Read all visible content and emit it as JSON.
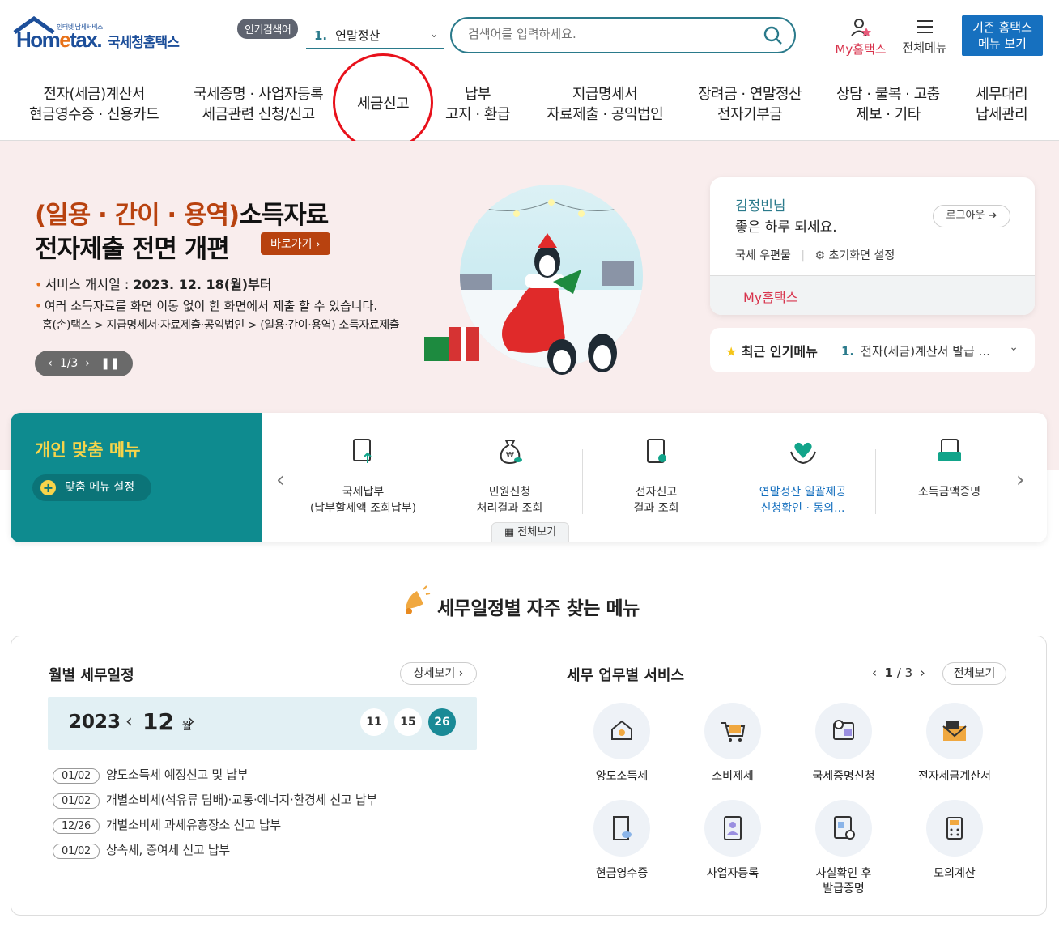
{
  "header": {
    "logo_small": "인터넷 납세서비스",
    "logo_main_a": "Hom",
    "logo_main_b": "e",
    "logo_main_c": "tax.",
    "logo_kr": "국세청홈택스",
    "popular_badge": "인기검색어",
    "popular_num": "1.",
    "popular_value": "연말정산",
    "search_placeholder": "검색어를 입력하세요.",
    "my_hometax": "My홈택스",
    "all_menu": "전체메뉴",
    "old_menu_line1": "기존 홈택스",
    "old_menu_line2": "메뉴 보기"
  },
  "nav": [
    {
      "l1": "전자(세금)계산서",
      "l2": "현금영수증 · 신용카드"
    },
    {
      "l1": "국세증명 · 사업자등록",
      "l2": "세금관련 신청/신고"
    },
    {
      "l1": "세금신고",
      "l2": ""
    },
    {
      "l1": "납부",
      "l2": "고지 · 환급"
    },
    {
      "l1": "지급명세서",
      "l2": "자료제출 · 공익법인"
    },
    {
      "l1": "장려금 · 연말정산",
      "l2": "전자기부금"
    },
    {
      "l1": "상담 · 불복 · 고충",
      "l2": "제보 · 기타"
    },
    {
      "l1": "세무대리",
      "l2": "납세관리"
    }
  ],
  "banner": {
    "title_highlight": "(일용 · 간이 · 용역)",
    "title_rest": "소득자료",
    "title2": "전자제출 전면 개편",
    "go_button": "바로가기",
    "line1_label": "서비스 개시일 : ",
    "line1_value": "2023. 12. 18(월)부터",
    "line2": "여러 소득자료를 화면 이동 없이 한 화면에서 제출 할 수 있습니다.",
    "line3": "홈(손)택스 > 지급명세서·자료제출·공익법인 > (일용·간이·용역) 소득자료제출",
    "pager": "1/3"
  },
  "login": {
    "user": "김정빈",
    "suffix": "님",
    "greeting": "좋은 하루 되세요.",
    "logout": "로그아웃",
    "mail": "국세 우편물",
    "settings": "초기화면 설정",
    "my_hometax": "My홈택스"
  },
  "recent": {
    "label": "최근 인기메뉴",
    "num": "1.",
    "value": "전자(세금)계산서 발급 ..."
  },
  "personal": {
    "title_a": "개인",
    "title_b": " 맞춤 메뉴",
    "setting": "맞춤 메뉴 설정",
    "view_all": "전체보기",
    "items": [
      {
        "l1": "국세납부",
        "l2": "(납부할세액 조회납부)"
      },
      {
        "l1": "민원신청",
        "l2": "처리결과 조회"
      },
      {
        "l1": "전자신고",
        "l2": "결과 조회"
      },
      {
        "l1": "연말정산 일괄제공",
        "l2": "신청확인 · 동의..."
      },
      {
        "l1": "소득금액증명",
        "l2": ""
      }
    ]
  },
  "schedule_section": {
    "title": "세무일정별 자주 찾는 메뉴",
    "monthly_title": "월별 세무일정",
    "detail_button": "상세보기",
    "year": "2023",
    "month": "12",
    "month_unit": "월",
    "days": [
      "11",
      "15",
      "26"
    ],
    "selected_day": "26",
    "items": [
      {
        "date": "01/02",
        "text": "양도소득세 예정신고 및 납부"
      },
      {
        "date": "01/02",
        "text": "개별소비세(석유류 담배)·교통·에너지·환경세 신고 납부"
      },
      {
        "date": "12/26",
        "text": "개별소비세 과세유흥장소 신고 납부"
      },
      {
        "date": "01/02",
        "text": "상속세, 증여세 신고 납부"
      }
    ],
    "service_title": "세무 업무별 서비스",
    "service_page_current": "1",
    "service_page_total": "3",
    "service_all": "전체보기",
    "services": [
      {
        "l1": "양도소득세",
        "l2": ""
      },
      {
        "l1": "소비제세",
        "l2": ""
      },
      {
        "l1": "국세증명신청",
        "l2": ""
      },
      {
        "l1": "전자세금계산서",
        "l2": ""
      },
      {
        "l1": "현금영수증",
        "l2": ""
      },
      {
        "l1": "사업자등록",
        "l2": ""
      },
      {
        "l1": "사실확인 후",
        "l2": "발급증명"
      },
      {
        "l1": "모의계산",
        "l2": ""
      }
    ]
  }
}
